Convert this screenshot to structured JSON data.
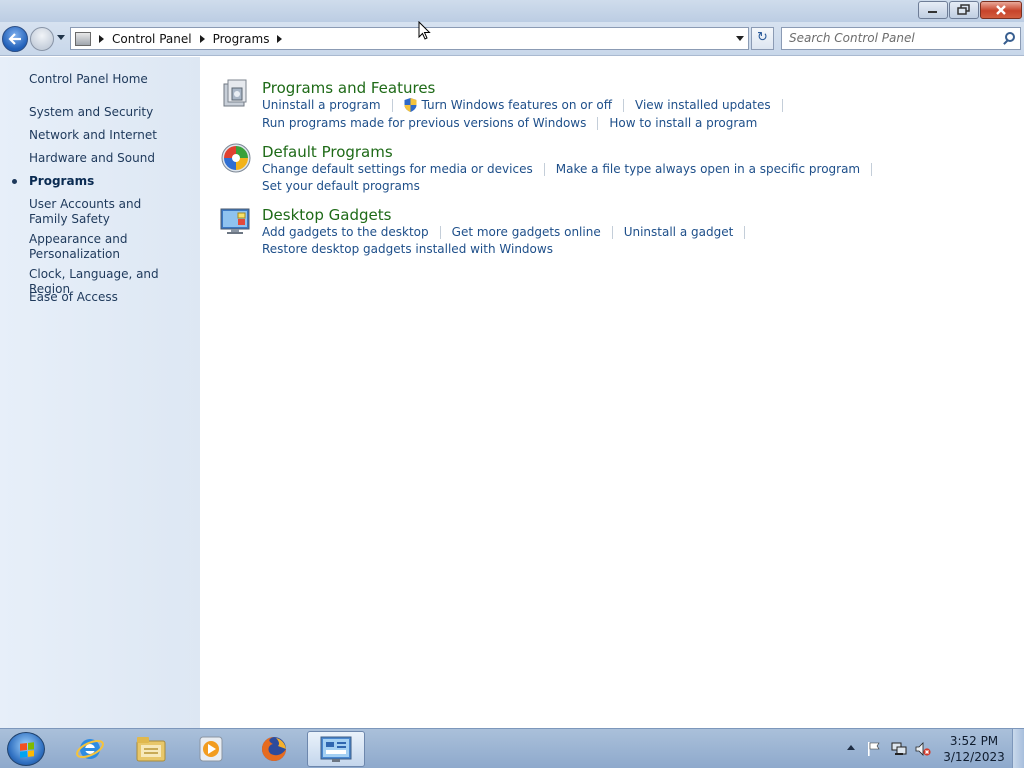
{
  "window": {
    "buttons": {
      "minimize": "minimize",
      "maximize": "restore",
      "close": "close"
    }
  },
  "navbar": {
    "breadcrumb": [
      "Control Panel",
      "Programs"
    ],
    "search_placeholder": "Search Control Panel"
  },
  "sidebar": {
    "items": [
      {
        "label": "Control Panel Home",
        "active": false
      },
      {
        "label": "System and Security",
        "active": false
      },
      {
        "label": "Network and Internet",
        "active": false
      },
      {
        "label": "Hardware and Sound",
        "active": false
      },
      {
        "label": "Programs",
        "active": true
      },
      {
        "label": "User Accounts and Family Safety",
        "active": false
      },
      {
        "label": "Appearance and Personalization",
        "active": false
      },
      {
        "label": "Clock, Language, and Region",
        "active": false
      },
      {
        "label": "Ease of Access",
        "active": false
      }
    ]
  },
  "main": {
    "categories": [
      {
        "title": "Programs and Features",
        "icon": "programs-features-icon",
        "row1": [
          "Uninstall a program",
          "Turn Windows features on or off",
          "View installed updates"
        ],
        "row2": [
          "Run programs made for previous versions of Windows",
          "How to install a program"
        ]
      },
      {
        "title": "Default Programs",
        "icon": "default-programs-icon",
        "row1": [
          "Change default settings for media or devices",
          "Make a file type always open in a specific program"
        ],
        "row2": [
          "Set your default programs"
        ]
      },
      {
        "title": "Desktop Gadgets",
        "icon": "desktop-gadgets-icon",
        "row1": [
          "Add gadgets to the desktop",
          "Get more gadgets online",
          "Uninstall a gadget"
        ],
        "row2": [
          "Restore desktop gadgets installed with Windows"
        ]
      }
    ]
  },
  "taskbar": {
    "pinned": [
      "internet-explorer-icon",
      "windows-explorer-icon",
      "media-player-icon",
      "firefox-icon",
      "control-panel-icon"
    ],
    "clock": {
      "time": "3:52 PM",
      "date": "3/12/2023"
    }
  },
  "colors": {
    "link": "#1e4f8a",
    "category_title": "#1e6a17",
    "sidebar_bg": "#e4ecf7"
  }
}
